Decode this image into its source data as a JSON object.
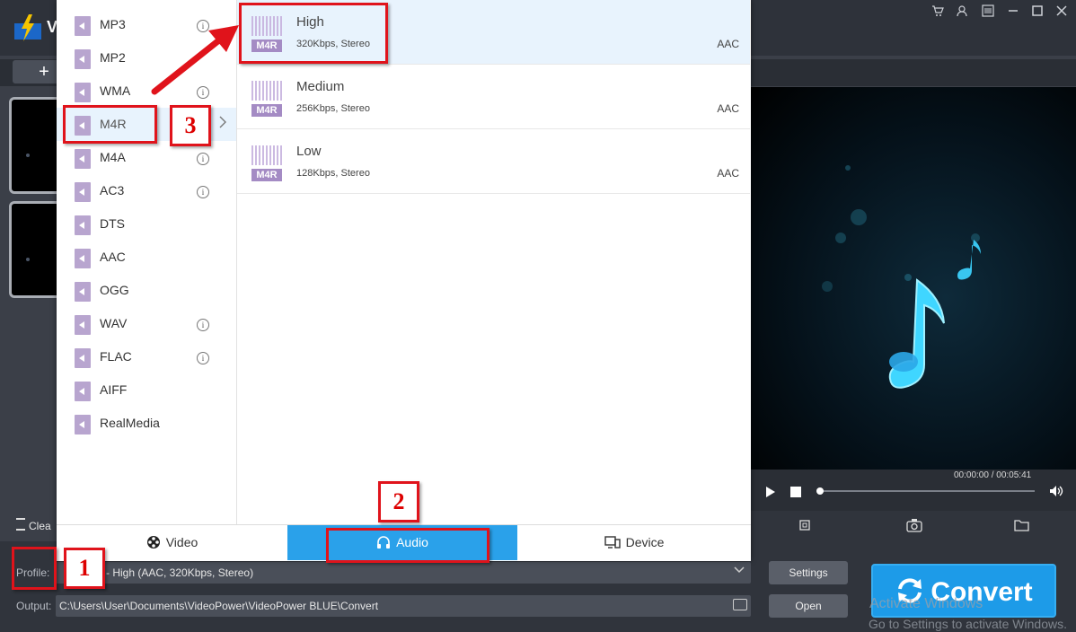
{
  "app": {
    "title_initial": "V",
    "add_label": "+",
    "clear_label": "Clea",
    "window_controls": [
      "cart-icon",
      "user-icon",
      "menu-icon",
      "minimize-icon",
      "maximize-icon",
      "close-icon"
    ]
  },
  "popup": {
    "formats": [
      {
        "label": "MP3",
        "info": true
      },
      {
        "label": "MP2",
        "info": false
      },
      {
        "label": "WMA",
        "info": true
      },
      {
        "label": "M4R",
        "info": false
      },
      {
        "label": "M4A",
        "info": true
      },
      {
        "label": "AC3",
        "info": true
      },
      {
        "label": "DTS",
        "info": false
      },
      {
        "label": "AAC",
        "info": false
      },
      {
        "label": "OGG",
        "info": false
      },
      {
        "label": "WAV",
        "info": true
      },
      {
        "label": "FLAC",
        "info": true
      },
      {
        "label": "AIFF",
        "info": false
      },
      {
        "label": "RealMedia",
        "info": false
      }
    ],
    "selected_format": "M4R",
    "qualities": [
      {
        "name": "High",
        "detail": "320Kbps, Stereo",
        "codec": "AAC",
        "badge": "M4R"
      },
      {
        "name": "Medium",
        "detail": "256Kbps, Stereo",
        "codec": "AAC",
        "badge": "M4R"
      },
      {
        "name": "Low",
        "detail": "128Kbps, Stereo",
        "codec": "AAC",
        "badge": "M4R"
      }
    ],
    "tabs": [
      {
        "label": "Video",
        "icon": "film-reel-icon"
      },
      {
        "label": "Audio",
        "icon": "headphones-icon"
      },
      {
        "label": "Device",
        "icon": "device-icon"
      }
    ],
    "active_tab": "Audio"
  },
  "profile": {
    "label": "Profile:",
    "value": "- High (AAC, 320Kbps, Stereo)",
    "settings_label": "Settings"
  },
  "output": {
    "label": "Output:",
    "path": "C:\\Users\\User\\Documents\\VideoPower\\VideoPower BLUE\\Convert",
    "open_label": "Open"
  },
  "convert": {
    "label": "Convert"
  },
  "player": {
    "time": "00:00:00 / 00:05:41",
    "progress": 0.0
  },
  "watermark": {
    "line1": "Activate Windows",
    "line2": "Go to Settings to activate Windows."
  },
  "annotations": [
    "1",
    "2",
    "3"
  ],
  "colors": {
    "accent": "#2aa1ea",
    "convert": "#1d9be8",
    "annotation": "#e0131b",
    "format_icon": "#b8a5cf"
  }
}
